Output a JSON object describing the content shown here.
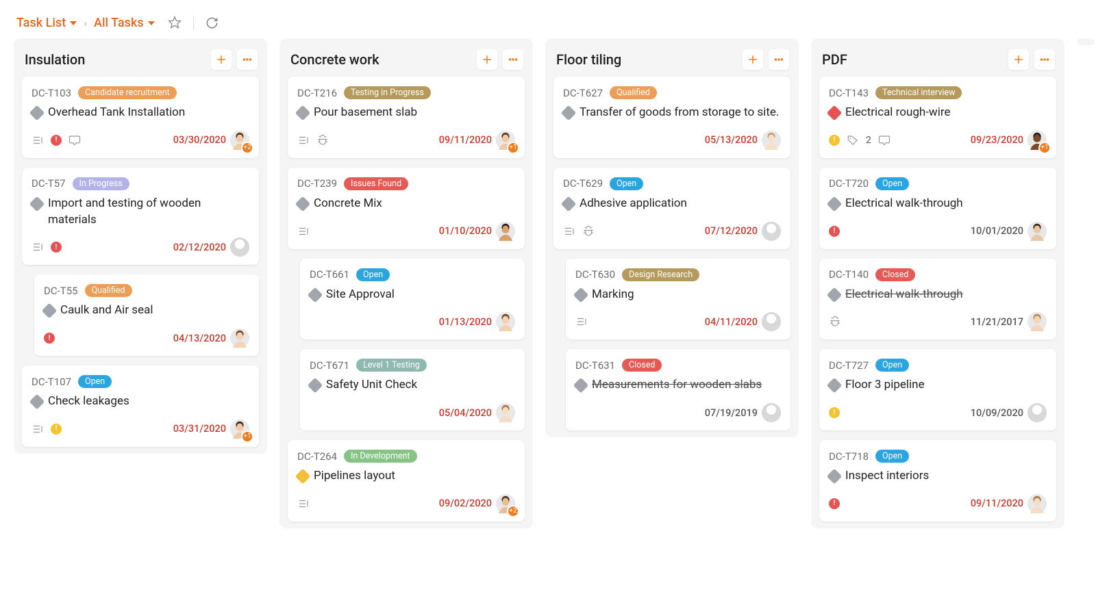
{
  "breadcrumb": {
    "first": "Task List",
    "second": "All Tasks"
  },
  "columns": [
    {
      "title": "Insulation",
      "cards": [
        {
          "id": "DC-T103",
          "status": {
            "label": "Candidate recruitment",
            "bg": "#ed9d55"
          },
          "diamond": "d-gray",
          "title": "Overhead Tank Installation",
          "subtasksIcon": true,
          "priorityDot": "dot-red",
          "commentIcon": true,
          "due": "03/30/2020",
          "dueColor": "due",
          "avatar": "person-m1",
          "avatarBadge": "+2",
          "indent": false
        },
        {
          "id": "DC-T57",
          "status": {
            "label": "In Progress",
            "bg": "#b3b3ea"
          },
          "diamond": "d-gray",
          "title": "Import and testing of wooden materials",
          "subtasksIcon": true,
          "priorityDot": "dot-red",
          "due": "02/12/2020",
          "dueColor": "due",
          "avatar": "placeholder",
          "indent": false
        },
        {
          "id": "DC-T55",
          "status": {
            "label": "Qualified",
            "bg": "#ed9d55"
          },
          "diamond": "d-gray",
          "title": "Caulk and Air seal",
          "priorityDot": "dot-red",
          "due": "04/13/2020",
          "dueColor": "due",
          "avatar": "person-f1",
          "indent": true
        },
        {
          "id": "DC-T107",
          "status": {
            "label": "Open",
            "bg": "#2aa5e0"
          },
          "diamond": "d-gray",
          "title": "Check leakages",
          "subtasksIcon": true,
          "priorityDot": "dot-yellow",
          "due": "03/31/2020",
          "dueColor": "due",
          "avatar": "person-m2",
          "avatarBadge": "+1",
          "indent": false
        }
      ]
    },
    {
      "title": "Concrete work",
      "cards": [
        {
          "id": "DC-T216",
          "status": {
            "label": "Testing in Progress",
            "bg": "#b59a5b"
          },
          "diamond": "d-gray",
          "title": "Pour basement slab",
          "subtasksIcon": true,
          "bugIcon": true,
          "due": "09/11/2020",
          "dueColor": "due",
          "avatar": "person-f2",
          "avatarBadge": "+1",
          "indent": false
        },
        {
          "id": "DC-T239",
          "status": {
            "label": "Issues Found",
            "bg": "#e65a55"
          },
          "diamond": "d-gray",
          "title": "Concrete Mix",
          "subtasksIcon": true,
          "due": "01/10/2020",
          "dueColor": "due",
          "avatar": "person-m3",
          "indent": false
        },
        {
          "id": "DC-T661",
          "status": {
            "label": "Open",
            "bg": "#2aa5e0"
          },
          "diamond": "d-gray",
          "title": "Site Approval",
          "due": "01/13/2020",
          "dueColor": "due",
          "avatar": "person-m4",
          "indent": true
        },
        {
          "id": "DC-T671",
          "status": {
            "label": "Level 1 Testing",
            "bg": "#8fb8b0"
          },
          "diamond": "d-gray",
          "title": "Safety Unit Check",
          "due": "05/04/2020",
          "dueColor": "due",
          "avatar": "person-f3",
          "indent": true
        },
        {
          "id": "DC-T264",
          "status": {
            "label": "In Development",
            "bg": "#86c485"
          },
          "diamond": "d-yellow",
          "title": "Pipelines layout",
          "subtasksIcon": true,
          "due": "09/02/2020",
          "dueColor": "due",
          "avatar": "person-m5",
          "avatarBadge": "+2",
          "indent": false
        }
      ]
    },
    {
      "title": "Floor tiling",
      "cards": [
        {
          "id": "DC-T627",
          "status": {
            "label": "Qualified",
            "bg": "#ed9d55"
          },
          "diamond": "d-gray",
          "title": "Transfer of goods from storage to site.",
          "due": "05/13/2020",
          "dueColor": "due",
          "avatar": "person-f4",
          "indent": false
        },
        {
          "id": "DC-T629",
          "status": {
            "label": "Open",
            "bg": "#2aa5e0"
          },
          "diamond": "d-gray",
          "title": "Adhesive application",
          "subtasksIcon": true,
          "bugIcon": true,
          "due": "07/12/2020",
          "dueColor": "due",
          "avatar": "placeholder",
          "indent": false
        },
        {
          "id": "DC-T630",
          "status": {
            "label": "Design Research",
            "bg": "#b59a5b"
          },
          "diamond": "d-gray",
          "title": "Marking",
          "subtasksIcon": true,
          "due": "04/11/2020",
          "dueColor": "due",
          "avatar": "placeholder",
          "indent": true
        },
        {
          "id": "DC-T631",
          "status": {
            "label": "Closed",
            "bg": "#e65a55"
          },
          "diamond": "d-gray",
          "title": "Measurements for wooden slabs",
          "strike": true,
          "due": "07/19/2019",
          "dueColor": "due-dark",
          "avatar": "placeholder",
          "indent": true
        }
      ]
    },
    {
      "title": "PDF",
      "cards": [
        {
          "id": "DC-T143",
          "status": {
            "label": "Technical interview",
            "bg": "#b59a5b"
          },
          "diamond": "d-red",
          "title": "Electrical rough-wire",
          "priorityDot": "dot-yellow",
          "tagIcon": true,
          "tagCount": "2",
          "commentIcon": true,
          "due": "09/23/2020",
          "dueColor": "due",
          "avatar": "person-f5",
          "avatarBadge": "+1",
          "indent": false
        },
        {
          "id": "DC-T720",
          "status": {
            "label": "Open",
            "bg": "#2aa5e0"
          },
          "diamond": "d-gray",
          "title": "Electrical walk-through",
          "priorityDot": "dot-red",
          "due": "10/01/2020",
          "dueColor": "due-dark",
          "avatar": "person-m6",
          "indent": false
        },
        {
          "id": "DC-T140",
          "status": {
            "label": "Closed",
            "bg": "#e65a55"
          },
          "diamond": "d-gray",
          "title": "Electrical walk-through",
          "strike": true,
          "bugIcon": true,
          "due": "11/21/2017",
          "dueColor": "due-dark",
          "avatar": "person-f6",
          "indent": false
        },
        {
          "id": "DC-T727",
          "status": {
            "label": "Open",
            "bg": "#2aa5e0"
          },
          "diamond": "d-gray",
          "title": "Floor 3 pipeline",
          "priorityDot": "dot-yellow",
          "due": "10/09/2020",
          "dueColor": "due-dark",
          "avatar": "placeholder",
          "indent": false
        },
        {
          "id": "DC-T718",
          "status": {
            "label": "Open",
            "bg": "#2aa5e0"
          },
          "diamond": "d-gray",
          "title": "Inspect interiors",
          "priorityDot": "dot-red",
          "due": "09/11/2020",
          "dueColor": "due",
          "avatar": "person-f7",
          "indent": false
        }
      ]
    }
  ]
}
